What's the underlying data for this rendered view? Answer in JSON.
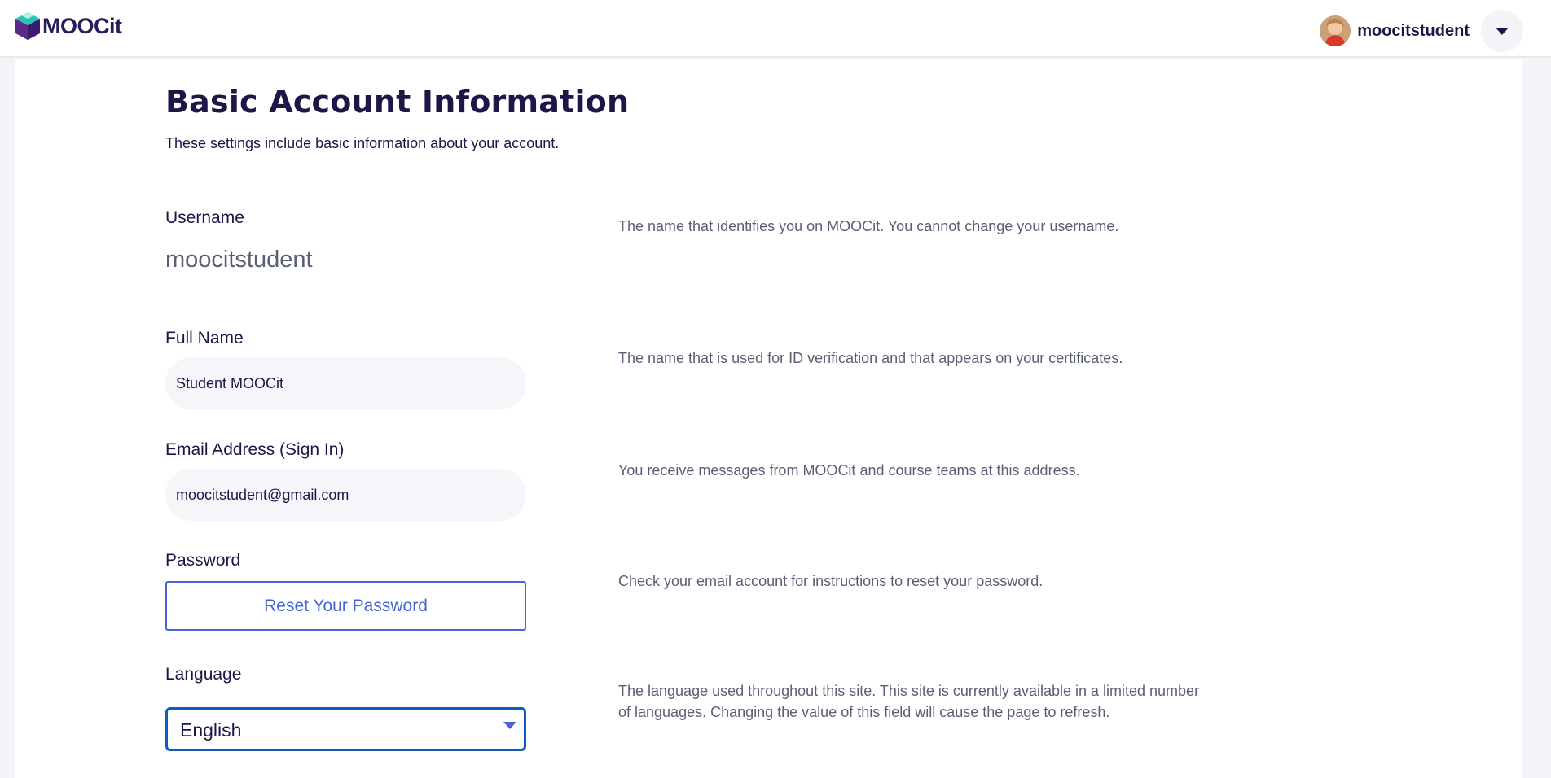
{
  "header": {
    "logo_text": "MOOCit",
    "username": "moocitstudent",
    "accent_color": "#2a1b5c"
  },
  "main": {
    "title": "Basic Account Information",
    "subtitle": "These settings include basic information about your account."
  },
  "fields": {
    "username": {
      "label": "Username",
      "value": "moocitstudent",
      "help": "The name that identifies you on MOOCit. You cannot change your username."
    },
    "full_name": {
      "label": "Full Name",
      "value": "Student MOOCit",
      "help": "The name that is used for ID verification and that appears on your certificates."
    },
    "email": {
      "label": "Email Address (Sign In)",
      "value": "moocitstudent@gmail.com",
      "help": "You receive messages from MOOCit and course teams at this address."
    },
    "password": {
      "label": "Password",
      "button_label": "Reset Your Password",
      "help": "Check your email account for instructions to reset your password."
    },
    "language": {
      "label": "Language",
      "selected": "English",
      "help_line1": "The language used throughout this site. This site is currently available in a limited number",
      "help_line2": "of languages. Changing the value of this field will cause the page to refresh."
    }
  },
  "icons": {
    "logo": "cube-logo-icon",
    "user_menu": "chevron-down-icon",
    "select": "caret-down-icon"
  },
  "colors": {
    "link_blue": "#4665d4",
    "focus_blue": "#0b5cc4",
    "text_primary": "#1f1547",
    "text_muted": "#5a5f73"
  }
}
